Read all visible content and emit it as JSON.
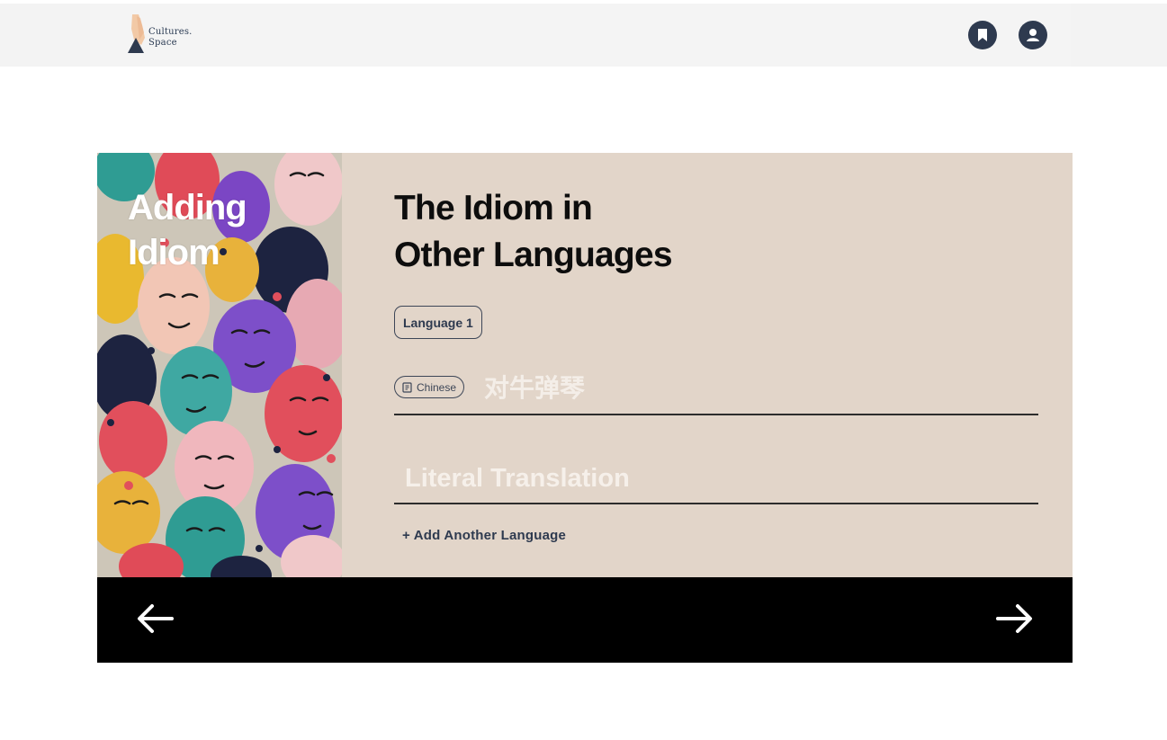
{
  "header": {
    "logo": {
      "line1": "Cultures.",
      "line2": "Space"
    },
    "icons": {
      "bookmark": "bookmark-icon",
      "profile": "user-icon"
    }
  },
  "sidebar_art": {
    "title_line1": "Adding",
    "title_line2": "Idiom"
  },
  "form": {
    "heading_line1": "The Idiom in",
    "heading_line2": "Other Languages",
    "language_tag": "Language 1",
    "language_pill": "Chinese",
    "idiom_value": "对牛弹琴",
    "translation_placeholder": "Literal Translation",
    "add_language_link": "+ Add Another Language"
  },
  "navigation": {
    "back_icon": "arrow-left-icon",
    "next_icon": "arrow-right-icon"
  },
  "colors": {
    "panel_bg": "#e2d5c9",
    "accent_dark": "#2e3a4f",
    "nav_bar": "#000000",
    "header_bg": "#f3f3f3"
  }
}
